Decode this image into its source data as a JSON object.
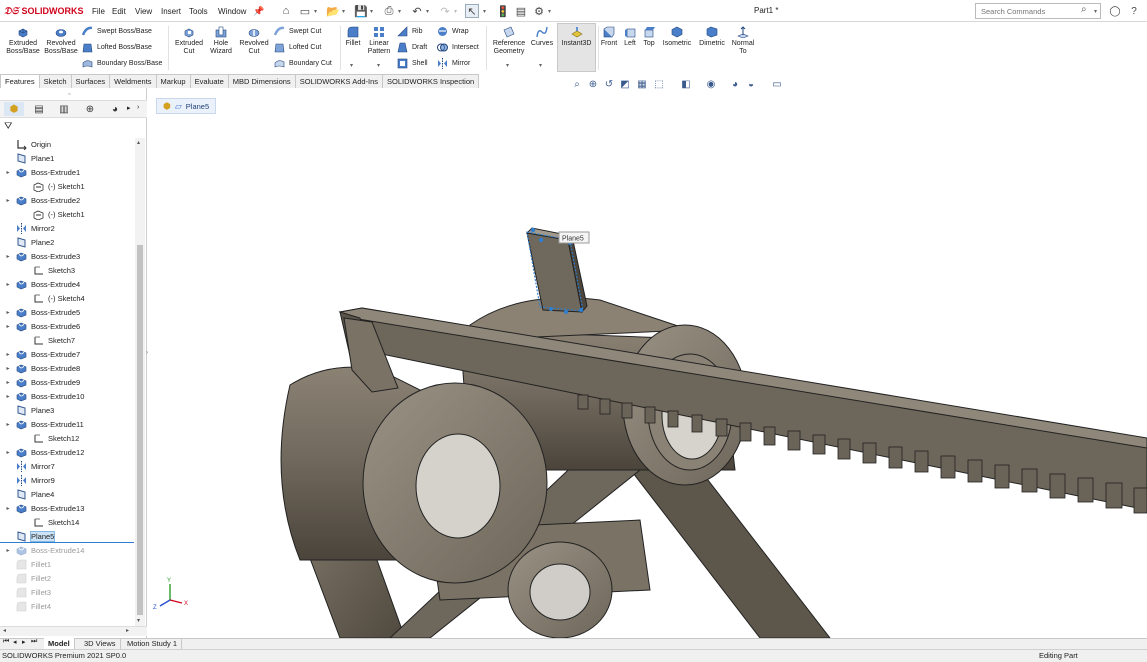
{
  "app": {
    "brand": "SOLIDWORKS",
    "doc_title": "Part1 *",
    "accent": "#d0021b"
  },
  "menu": [
    "File",
    "Edit",
    "View",
    "Insert",
    "Tools",
    "Window"
  ],
  "search": {
    "placeholder": "Search Commands"
  },
  "commands": {
    "extruded_boss": "Extruded Boss/Base",
    "revolved_boss": "Revolved Boss/Base",
    "swept_boss": "Swept Boss/Base",
    "lofted_boss": "Lofted Boss/Base",
    "boundary_boss": "Boundary Boss/Base",
    "extruded_cut": "Extruded Cut",
    "hole_wizard": "Hole Wizard",
    "revolved_cut": "Revolved Cut",
    "swept_cut": "Swept Cut",
    "lofted_cut": "Lofted Cut",
    "boundary_cut": "Boundary Cut",
    "fillet": "Fillet",
    "linear_pattern": "Linear Pattern",
    "rib": "Rib",
    "draft": "Draft",
    "shell": "Shell",
    "wrap": "Wrap",
    "intersect": "Intersect",
    "mirror": "Mirror",
    "reference_geometry": "Reference Geometry",
    "curves": "Curves",
    "instant3d": "Instant3D",
    "front": "Front",
    "left": "Left",
    "top": "Top",
    "isometric": "Isometric",
    "dimetric": "Dimetric",
    "normal_to": "Normal To"
  },
  "tabs": [
    "Features",
    "Sketch",
    "Surfaces",
    "Weldments",
    "Markup",
    "Evaluate",
    "MBD Dimensions",
    "SOLIDWORKS Add-Ins",
    "SOLIDWORKS Inspection"
  ],
  "active_tab": "Features",
  "breadcrumb": "Plane5",
  "plane_callout": "Plane5",
  "tree": [
    {
      "label": "Origin",
      "icon": "origin",
      "indent": 0,
      "arrow": false,
      "state": "normal"
    },
    {
      "label": "Plane1",
      "icon": "plane",
      "indent": 0,
      "arrow": false,
      "state": "normal"
    },
    {
      "label": "Boss-Extrude1",
      "icon": "feature",
      "indent": 0,
      "arrow": true,
      "state": "normal"
    },
    {
      "label": "(-) Sketch1",
      "icon": "sketch3d",
      "indent": 1,
      "arrow": false,
      "state": "normal"
    },
    {
      "label": "Boss-Extrude2",
      "icon": "feature",
      "indent": 0,
      "arrow": true,
      "state": "normal"
    },
    {
      "label": "(-) Sketch1",
      "icon": "sketch3d",
      "indent": 1,
      "arrow": false,
      "state": "normal"
    },
    {
      "label": "Mirror2",
      "icon": "mirror",
      "indent": 0,
      "arrow": false,
      "state": "normal"
    },
    {
      "label": "Plane2",
      "icon": "plane",
      "indent": 0,
      "arrow": false,
      "state": "normal"
    },
    {
      "label": "Boss-Extrude3",
      "icon": "feature",
      "indent": 0,
      "arrow": true,
      "state": "normal"
    },
    {
      "label": "Sketch3",
      "icon": "sketch",
      "indent": 1,
      "arrow": false,
      "state": "normal"
    },
    {
      "label": "Boss-Extrude4",
      "icon": "feature",
      "indent": 0,
      "arrow": true,
      "state": "normal"
    },
    {
      "label": "(-) Sketch4",
      "icon": "sketch",
      "indent": 1,
      "arrow": false,
      "state": "normal"
    },
    {
      "label": "Boss-Extrude5",
      "icon": "feature",
      "indent": 0,
      "arrow": true,
      "state": "normal"
    },
    {
      "label": "Boss-Extrude6",
      "icon": "feature",
      "indent": 0,
      "arrow": true,
      "state": "normal"
    },
    {
      "label": "Sketch7",
      "icon": "sketch",
      "indent": 1,
      "arrow": false,
      "state": "normal"
    },
    {
      "label": "Boss-Extrude7",
      "icon": "feature",
      "indent": 0,
      "arrow": true,
      "state": "normal"
    },
    {
      "label": "Boss-Extrude8",
      "icon": "feature",
      "indent": 0,
      "arrow": true,
      "state": "normal"
    },
    {
      "label": "Boss-Extrude9",
      "icon": "feature",
      "indent": 0,
      "arrow": true,
      "state": "normal"
    },
    {
      "label": "Boss-Extrude10",
      "icon": "feature",
      "indent": 0,
      "arrow": true,
      "state": "normal"
    },
    {
      "label": "Plane3",
      "icon": "plane",
      "indent": 0,
      "arrow": false,
      "state": "normal"
    },
    {
      "label": "Boss-Extrude11",
      "icon": "feature",
      "indent": 0,
      "arrow": true,
      "state": "normal"
    },
    {
      "label": "Sketch12",
      "icon": "sketch",
      "indent": 1,
      "arrow": false,
      "state": "normal"
    },
    {
      "label": "Boss-Extrude12",
      "icon": "feature",
      "indent": 0,
      "arrow": true,
      "state": "normal"
    },
    {
      "label": "Mirror7",
      "icon": "mirror",
      "indent": 0,
      "arrow": false,
      "state": "normal"
    },
    {
      "label": "Mirror9",
      "icon": "mirror",
      "indent": 0,
      "arrow": false,
      "state": "normal"
    },
    {
      "label": "Plane4",
      "icon": "plane",
      "indent": 0,
      "arrow": false,
      "state": "normal"
    },
    {
      "label": "Boss-Extrude13",
      "icon": "feature",
      "indent": 0,
      "arrow": true,
      "state": "normal"
    },
    {
      "label": "Sketch14",
      "icon": "sketch",
      "indent": 1,
      "arrow": false,
      "state": "normal"
    },
    {
      "label": "Plane5",
      "icon": "plane",
      "indent": 0,
      "arrow": false,
      "state": "selected"
    },
    {
      "label": "Boss-Extrude14",
      "icon": "feature",
      "indent": 0,
      "arrow": true,
      "state": "suppressed"
    },
    {
      "label": "Fillet1",
      "icon": "fillet",
      "indent": 0,
      "arrow": false,
      "state": "suppressed"
    },
    {
      "label": "Fillet2",
      "icon": "fillet",
      "indent": 0,
      "arrow": false,
      "state": "suppressed"
    },
    {
      "label": "Fillet3",
      "icon": "fillet",
      "indent": 0,
      "arrow": false,
      "state": "suppressed"
    },
    {
      "label": "Fillet4",
      "icon": "fillet",
      "indent": 0,
      "arrow": false,
      "state": "suppressed"
    }
  ],
  "bottom_tabs": [
    "Model",
    "3D Views",
    "Motion Study 1"
  ],
  "status": {
    "left": "SOLIDWORKS Premium 2021 SP0.0",
    "right": "Editing Part"
  },
  "triad": {
    "x": "X",
    "y": "Y",
    "z": "Z"
  }
}
